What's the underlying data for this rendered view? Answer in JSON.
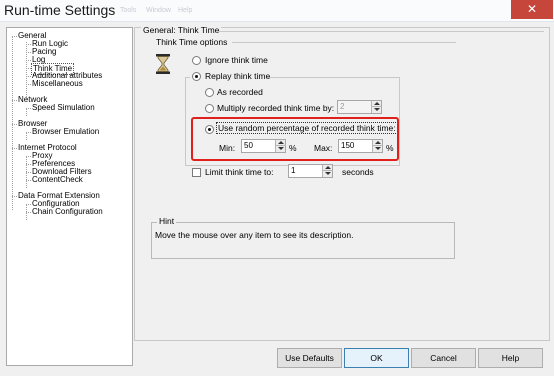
{
  "window": {
    "title": "Run-time Settings",
    "menu": [
      "Tools",
      "Window",
      "Help"
    ],
    "close_glyph": "✕"
  },
  "tree": {
    "general": "General",
    "run_logic": "Run Logic",
    "pacing": "Pacing",
    "log": "Log",
    "think_time": "Think Time",
    "additional_attributes": "Additional attributes",
    "miscellaneous": "Miscellaneous",
    "network": "Network",
    "speed_simulation": "Speed Simulation",
    "browser": "Browser",
    "browser_emulation": "Browser Emulation",
    "internet_protocol": "Internet Protocol",
    "proxy": "Proxy",
    "preferences": "Preferences",
    "download_filters": "Download Filters",
    "content_check": "ContentCheck",
    "data_format_extension": "Data Format Extension",
    "configuration": "Configuration",
    "chain_configuration": "Chain Configuration"
  },
  "panel": {
    "header": "General: Think Time",
    "options_group": "Think Time options",
    "ignore": "Ignore think time",
    "replay": "Replay think time",
    "as_recorded": "As recorded",
    "multiply": "Multiply recorded think time by:",
    "multiply_value": "2",
    "use_random": "Use random percentage of recorded think time:",
    "min_label": "Min:",
    "min_value": "50",
    "percent": "%",
    "max_label": "Max:",
    "max_value": "150",
    "limit": "Limit think time to:",
    "limit_value": "1",
    "seconds": "seconds",
    "hint_label": "Hint",
    "hint_text": "Move the mouse over any item to see its description."
  },
  "buttons": {
    "use_defaults": "Use Defaults",
    "ok": "OK",
    "cancel": "Cancel",
    "help": "Help"
  },
  "colors": {
    "highlight": "#e0201a",
    "close": "#c7463c"
  }
}
